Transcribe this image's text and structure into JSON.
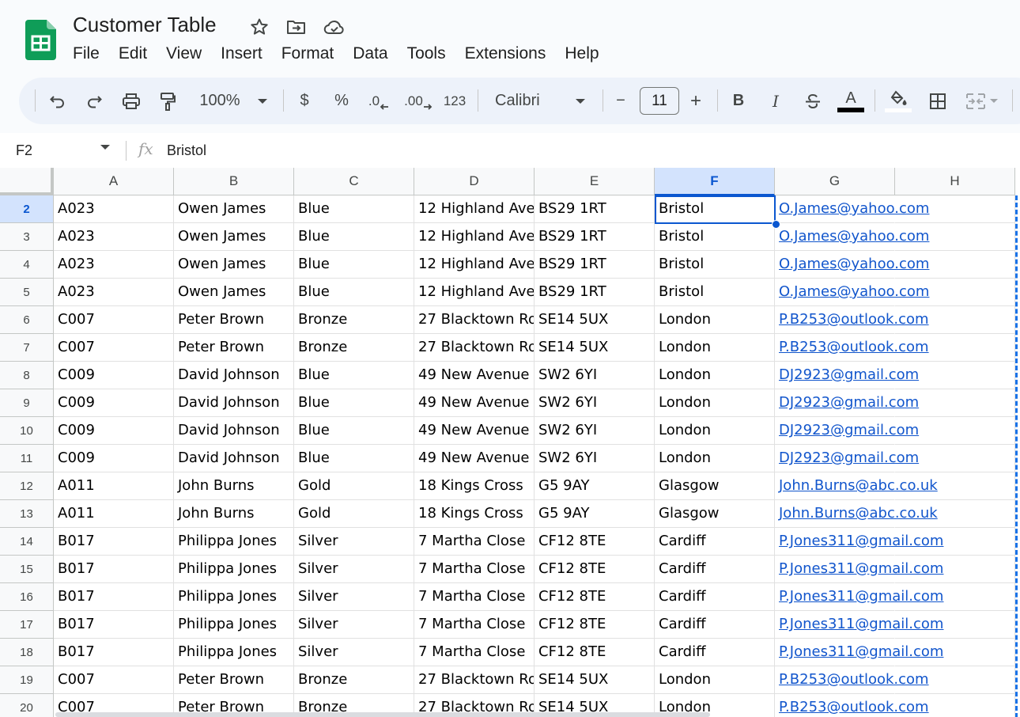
{
  "doc": {
    "title": "Customer Table"
  },
  "menu": [
    "File",
    "Edit",
    "View",
    "Insert",
    "Format",
    "Data",
    "Tools",
    "Extensions",
    "Help"
  ],
  "toolbar": {
    "zoom": "100%",
    "currency": "$",
    "percent": "%",
    "decrease_decimal": ".0",
    "increase_decimal": ".00",
    "more_formats": "123",
    "font": "Calibri",
    "font_size": "11",
    "minus": "−",
    "plus": "+",
    "bold": "B",
    "italic": "I",
    "text_color_letter": "A",
    "text_color": "#000000",
    "fill_color": "#ffffff"
  },
  "formula_bar": {
    "cell_ref": "F2",
    "fx": "fx",
    "value": "Bristol"
  },
  "columns": [
    "A",
    "B",
    "C",
    "D",
    "E",
    "F",
    "G",
    "H"
  ],
  "active_column": "F",
  "active_row": "2",
  "rows": [
    {
      "num": "2",
      "cells": [
        "A023",
        "Owen James",
        "Blue",
        "12 Highland Ave",
        "BS29 1RT",
        "Bristol",
        "O.James@yahoo.com"
      ]
    },
    {
      "num": "3",
      "cells": [
        "A023",
        "Owen James",
        "Blue",
        "12 Highland Ave",
        "BS29 1RT",
        "Bristol",
        "O.James@yahoo.com"
      ]
    },
    {
      "num": "4",
      "cells": [
        "A023",
        "Owen James",
        "Blue",
        "12 Highland Ave",
        "BS29 1RT",
        "Bristol",
        "O.James@yahoo.com"
      ]
    },
    {
      "num": "5",
      "cells": [
        "A023",
        "Owen James",
        "Blue",
        "12 Highland Ave",
        "BS29 1RT",
        "Bristol",
        "O.James@yahoo.com"
      ]
    },
    {
      "num": "6",
      "cells": [
        "C007",
        "Peter Brown",
        "Bronze",
        "27 Blacktown Ro",
        "SE14 5UX",
        "London",
        "P.B253@outlook.com"
      ]
    },
    {
      "num": "7",
      "cells": [
        "C007",
        "Peter Brown",
        "Bronze",
        "27 Blacktown Ro",
        "SE14 5UX",
        "London",
        "P.B253@outlook.com"
      ]
    },
    {
      "num": "8",
      "cells": [
        "C009",
        "David Johnson",
        "Blue",
        "49 New Avenue",
        "SW2 6YI",
        "London",
        "DJ2923@gmail.com"
      ]
    },
    {
      "num": "9",
      "cells": [
        "C009",
        "David Johnson",
        "Blue",
        "49 New Avenue",
        "SW2 6YI",
        "London",
        "DJ2923@gmail.com"
      ]
    },
    {
      "num": "10",
      "cells": [
        "C009",
        "David Johnson",
        "Blue",
        "49 New Avenue",
        "SW2 6YI",
        "London",
        "DJ2923@gmail.com"
      ]
    },
    {
      "num": "11",
      "cells": [
        "C009",
        "David Johnson",
        "Blue",
        "49 New Avenue",
        "SW2 6YI",
        "London",
        "DJ2923@gmail.com"
      ]
    },
    {
      "num": "12",
      "cells": [
        "A011",
        "John Burns",
        "Gold",
        "18 Kings Cross",
        "G5 9AY",
        "Glasgow",
        "John.Burns@abc.co.uk"
      ]
    },
    {
      "num": "13",
      "cells": [
        "A011",
        "John Burns",
        "Gold",
        "18 Kings Cross",
        "G5 9AY",
        "Glasgow",
        "John.Burns@abc.co.uk"
      ]
    },
    {
      "num": "14",
      "cells": [
        "B017",
        "Philippa Jones",
        "Silver",
        "7 Martha Close",
        "CF12 8TE",
        "Cardiff",
        "P.Jones311@gmail.com"
      ]
    },
    {
      "num": "15",
      "cells": [
        "B017",
        "Philippa Jones",
        "Silver",
        "7 Martha Close",
        "CF12 8TE",
        "Cardiff",
        "P.Jones311@gmail.com"
      ]
    },
    {
      "num": "16",
      "cells": [
        "B017",
        "Philippa Jones",
        "Silver",
        "7 Martha Close",
        "CF12 8TE",
        "Cardiff",
        "P.Jones311@gmail.com"
      ]
    },
    {
      "num": "17",
      "cells": [
        "B017",
        "Philippa Jones",
        "Silver",
        "7 Martha Close",
        "CF12 8TE",
        "Cardiff",
        "P.Jones311@gmail.com"
      ]
    },
    {
      "num": "18",
      "cells": [
        "B017",
        "Philippa Jones",
        "Silver",
        "7 Martha Close",
        "CF12 8TE",
        "Cardiff",
        "P.Jones311@gmail.com"
      ]
    },
    {
      "num": "19",
      "cells": [
        "C007",
        "Peter Brown",
        "Bronze",
        "27 Blacktown Ro",
        "SE14 5UX",
        "London",
        "P.B253@outlook.com"
      ]
    },
    {
      "num": "20",
      "cells": [
        "C007",
        "Peter Brown",
        "Bronze",
        "27 Blacktown Ro",
        "SE14 5UX",
        "London",
        "P.B253@outlook.com"
      ]
    }
  ],
  "colors": {
    "accent": "#0b57d0",
    "link": "#1155cc",
    "sheets_green": "#0f9d58",
    "toolbar_bg": "#edf2fa"
  }
}
